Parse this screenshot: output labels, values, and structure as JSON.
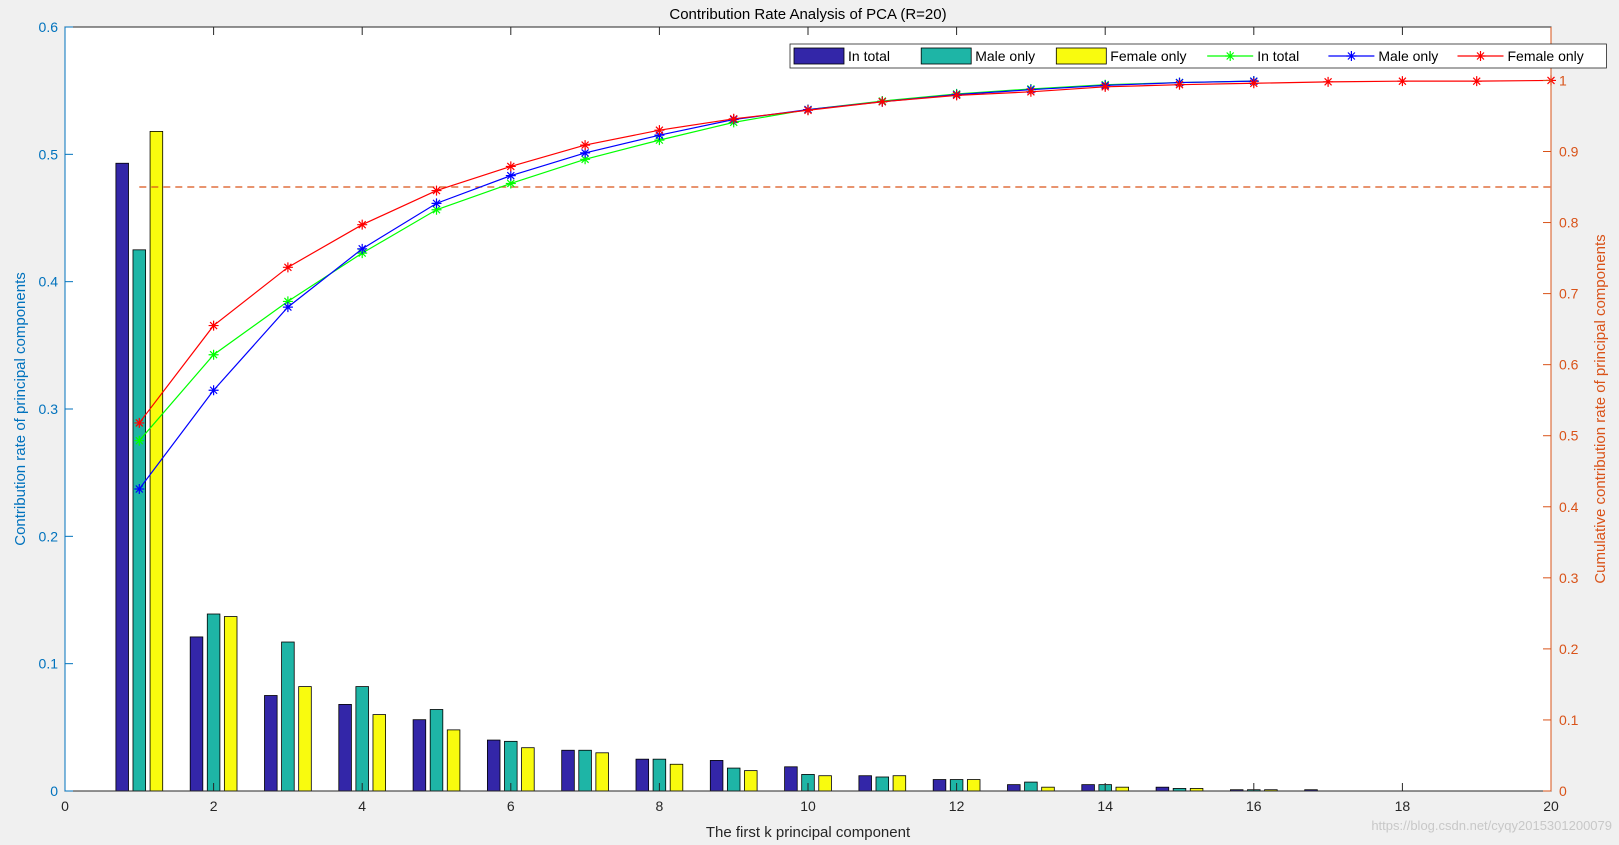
{
  "chart_data": {
    "type": "bar",
    "title": "Contribution Rate Analysis of PCA (R=20)",
    "xlabel": "The first k principal component",
    "ylabel_left": "Contribution rate of principal components",
    "ylabel_right": "Cumulative contribution rate of principal components",
    "xlim": [
      0,
      20
    ],
    "ylim_left": [
      0,
      0.6
    ],
    "ylim_right": [
      0,
      1.0752
    ],
    "xticks": [
      0,
      2,
      4,
      6,
      8,
      10,
      12,
      14,
      16,
      18,
      20
    ],
    "xtick_labels": [
      "0",
      "2",
      "4",
      "6",
      "8",
      "10",
      "12",
      "14",
      "16",
      "18",
      "20"
    ],
    "yticks_left": [
      0,
      0.1,
      0.2,
      0.3,
      0.4,
      0.5,
      0.6
    ],
    "ytick_labels_left": [
      "0",
      "0.1",
      "0.2",
      "0.3",
      "0.4",
      "0.5",
      "0.6"
    ],
    "yticks_right": [
      0,
      0.1,
      0.2,
      0.3,
      0.4,
      0.5,
      0.6,
      0.7,
      0.8,
      0.9,
      1
    ],
    "ytick_labels_right": [
      "0",
      "0.1",
      "0.2",
      "0.3",
      "0.4",
      "0.5",
      "0.6",
      "0.7",
      "0.8",
      "0.9",
      "1"
    ],
    "threshold_line": {
      "y_right": 0.85,
      "color": "#d95319",
      "style": "dashed"
    },
    "legend_position": "top-right",
    "grid": false,
    "bar_categories": [
      1,
      2,
      3,
      4,
      5,
      6,
      7,
      8,
      9,
      10,
      11,
      12,
      13,
      14,
      15,
      16,
      17,
      18,
      19,
      20
    ],
    "bar_series": [
      {
        "name": "In total",
        "color": "#3326a8",
        "values": [
          0.493,
          0.121,
          0.075,
          0.068,
          0.056,
          0.04,
          0.032,
          0.025,
          0.024,
          0.019,
          0.012,
          0.009,
          0.005,
          0.005,
          0.003,
          0.001,
          0.001,
          0.0,
          0.0,
          0.0
        ]
      },
      {
        "name": "Male only",
        "color": "#1eb5a6",
        "values": [
          0.425,
          0.139,
          0.117,
          0.082,
          0.064,
          0.039,
          0.032,
          0.025,
          0.018,
          0.013,
          0.011,
          0.009,
          0.007,
          0.005,
          0.002,
          0.001,
          0.0,
          0.0,
          0.0,
          0.0
        ]
      },
      {
        "name": "Female only",
        "color": "#f9fb0e",
        "values": [
          0.518,
          0.137,
          0.082,
          0.06,
          0.048,
          0.034,
          0.03,
          0.021,
          0.016,
          0.012,
          0.012,
          0.009,
          0.003,
          0.003,
          0.002,
          0.001,
          0.0,
          0.0,
          0.0,
          0.0
        ]
      }
    ],
    "line_series": [
      {
        "name": "In total",
        "color": "#00ff00",
        "x": [
          1,
          2,
          3,
          4,
          5,
          6,
          7,
          8,
          9,
          10,
          11,
          12,
          13,
          14,
          15,
          16
        ],
        "values": [
          0.493,
          0.614,
          0.689,
          0.757,
          0.818,
          0.855,
          0.889,
          0.916,
          0.941,
          0.959,
          0.971,
          0.981,
          0.988,
          0.994,
          0.997,
          0.999
        ]
      },
      {
        "name": "Male only",
        "color": "#0000ff",
        "x": [
          1,
          2,
          3,
          4,
          5,
          6,
          7,
          8,
          9,
          10,
          11,
          12,
          13,
          14,
          15,
          16
        ],
        "values": [
          0.425,
          0.564,
          0.681,
          0.763,
          0.827,
          0.866,
          0.898,
          0.923,
          0.945,
          0.959,
          0.97,
          0.98,
          0.987,
          0.993,
          0.997,
          0.999
        ]
      },
      {
        "name": "Female only",
        "color": "#ff0000",
        "x": [
          1,
          2,
          3,
          4,
          5,
          6,
          7,
          8,
          9,
          10,
          11,
          12,
          13,
          14,
          15,
          16,
          17,
          18,
          19,
          20
        ],
        "values": [
          0.518,
          0.655,
          0.737,
          0.797,
          0.845,
          0.879,
          0.909,
          0.93,
          0.946,
          0.958,
          0.97,
          0.979,
          0.984,
          0.991,
          0.994,
          0.996,
          0.998,
          0.999,
          0.999,
          1.0
        ]
      }
    ]
  },
  "watermark": "https://blog.csdn.net/cyqy2015301200079"
}
